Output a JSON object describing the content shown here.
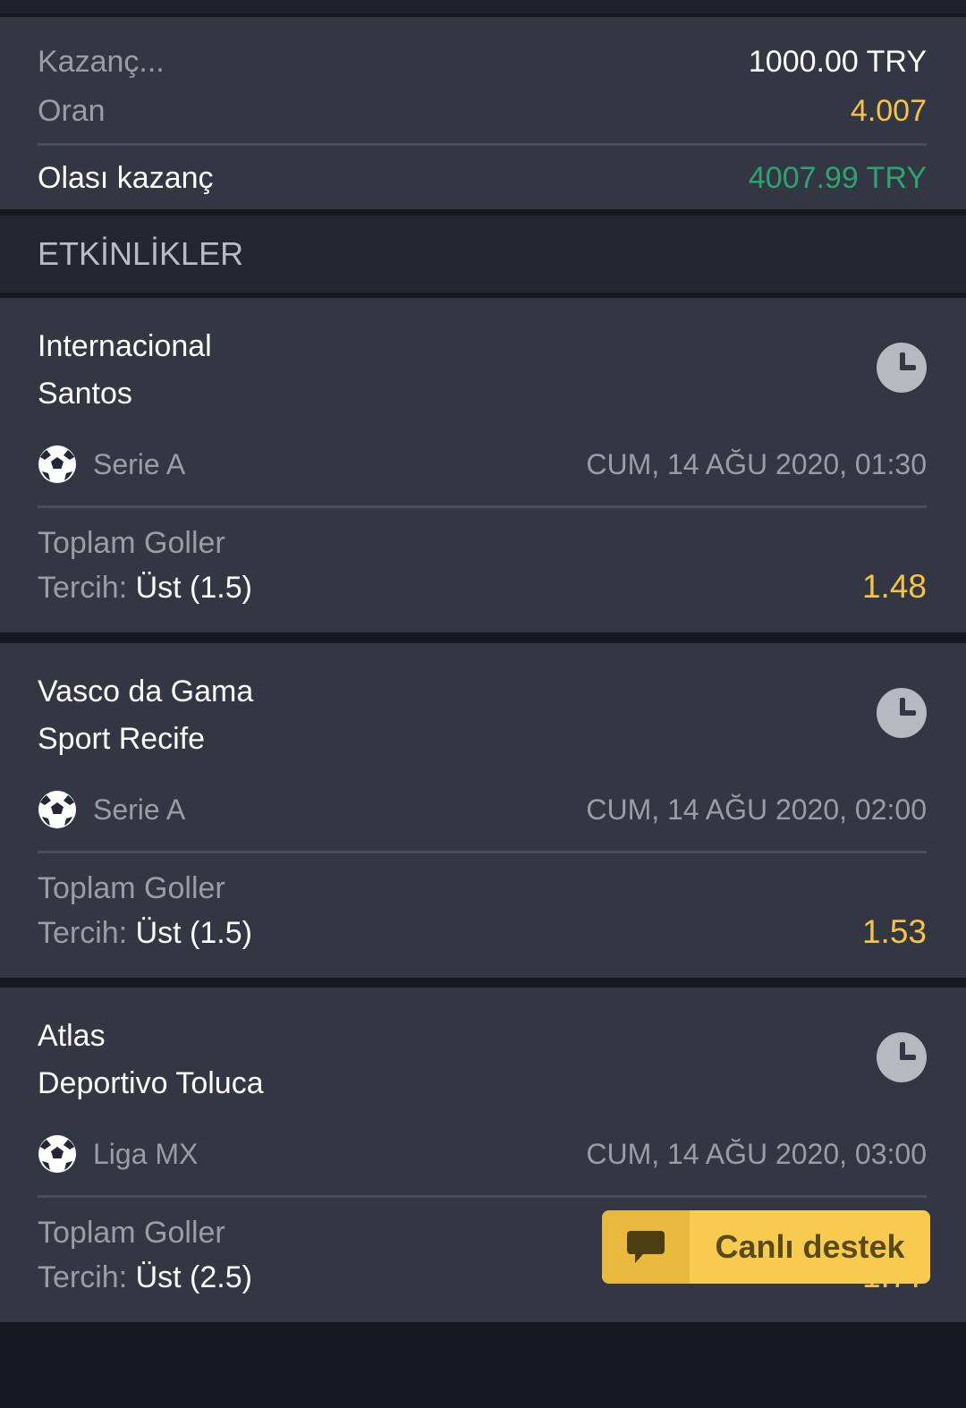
{
  "summary": {
    "stake_label": "Kazanç...",
    "stake_value": "1000.00 TRY",
    "odds_label": "Oran",
    "odds_value": "4.007",
    "potential_label": "Olası kazanç",
    "potential_value": "4007.99 TRY"
  },
  "section_title": "ETKİNLİKLER",
  "events": [
    {
      "home": "Internacional",
      "away": "Santos",
      "league": "Serie A",
      "date": "CUM, 14 AĞU 2020, 01:30",
      "market": "Toplam Goller",
      "choice_label": "Tercih:",
      "choice_value": "Üst (1.5)",
      "odds": "1.48"
    },
    {
      "home": "Vasco da Gama",
      "away": "Sport Recife",
      "league": "Serie A",
      "date": "CUM, 14 AĞU 2020, 02:00",
      "market": "Toplam Goller",
      "choice_label": "Tercih:",
      "choice_value": "Üst (1.5)",
      "odds": "1.53"
    },
    {
      "home": "Atlas",
      "away": "Deportivo Toluca",
      "league": "Liga MX",
      "date": "CUM, 14 AĞU 2020, 03:00",
      "market": "Toplam Goller",
      "choice_label": "Tercih:",
      "choice_value": "Üst (2.5)",
      "odds": "1.77"
    }
  ],
  "support": {
    "label": "Canlı destek",
    "icon": "chat-bubble-icon"
  },
  "colors": {
    "accent_yellow": "#f6c344",
    "win_green": "#2fa36f",
    "card_bg": "#333744"
  }
}
